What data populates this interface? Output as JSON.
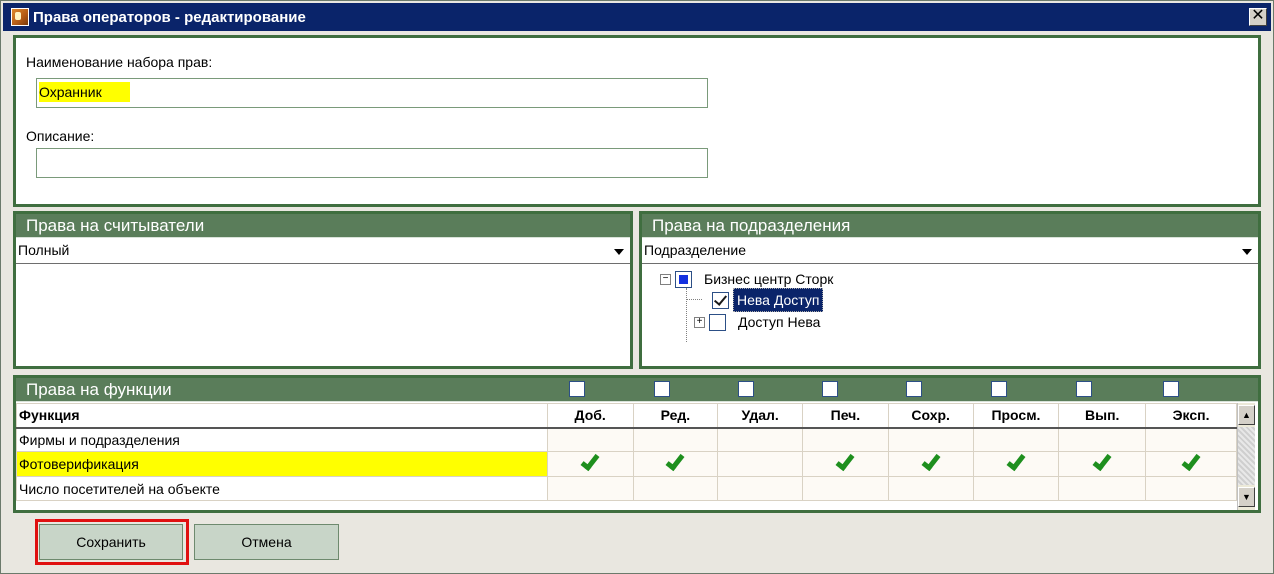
{
  "window": {
    "title": "Права операторов - редактирование",
    "close_glyph": "✕"
  },
  "general": {
    "name_label": "Наименование набора прав:",
    "name_value": "Охранник",
    "description_label": "Описание:",
    "description_value": ""
  },
  "readers": {
    "header": "Права на считыватели",
    "selected": "Полный"
  },
  "departments": {
    "header": "Права на подразделения",
    "selected": "Подразделение",
    "tree": [
      {
        "label": "Бизнес центр Сторк",
        "state": "partial",
        "expander": "−"
      },
      {
        "label": "Нева Доступ",
        "state": "checked",
        "selected": true
      },
      {
        "label": "Доступ Нева",
        "state": "unchecked",
        "expander": "+"
      }
    ]
  },
  "functions": {
    "header": "Права на функции",
    "columns": [
      "Функция",
      "Доб.",
      "Ред.",
      "Удал.",
      "Печ.",
      "Сохр.",
      "Просм.",
      "Вып.",
      "Эксп."
    ],
    "rows": [
      {
        "name": "Фирмы и подразделения",
        "checks": [
          false,
          false,
          false,
          false,
          false,
          false,
          false,
          false
        ],
        "highlight": false
      },
      {
        "name": "Фотоверификация",
        "checks": [
          true,
          true,
          false,
          true,
          true,
          true,
          true,
          true
        ],
        "highlight": true
      },
      {
        "name": "Число посетителей на объекте",
        "checks": [
          false,
          false,
          false,
          false,
          false,
          false,
          false,
          false
        ],
        "highlight": false
      }
    ]
  },
  "buttons": {
    "save": "Сохранить",
    "cancel": "Отмена"
  },
  "colors": {
    "panel_header": "#5a7d5a",
    "panel_border": "#3f6e3f",
    "highlight": "#ffff00",
    "check": "#1e8f1e",
    "focus": "#e01010"
  }
}
